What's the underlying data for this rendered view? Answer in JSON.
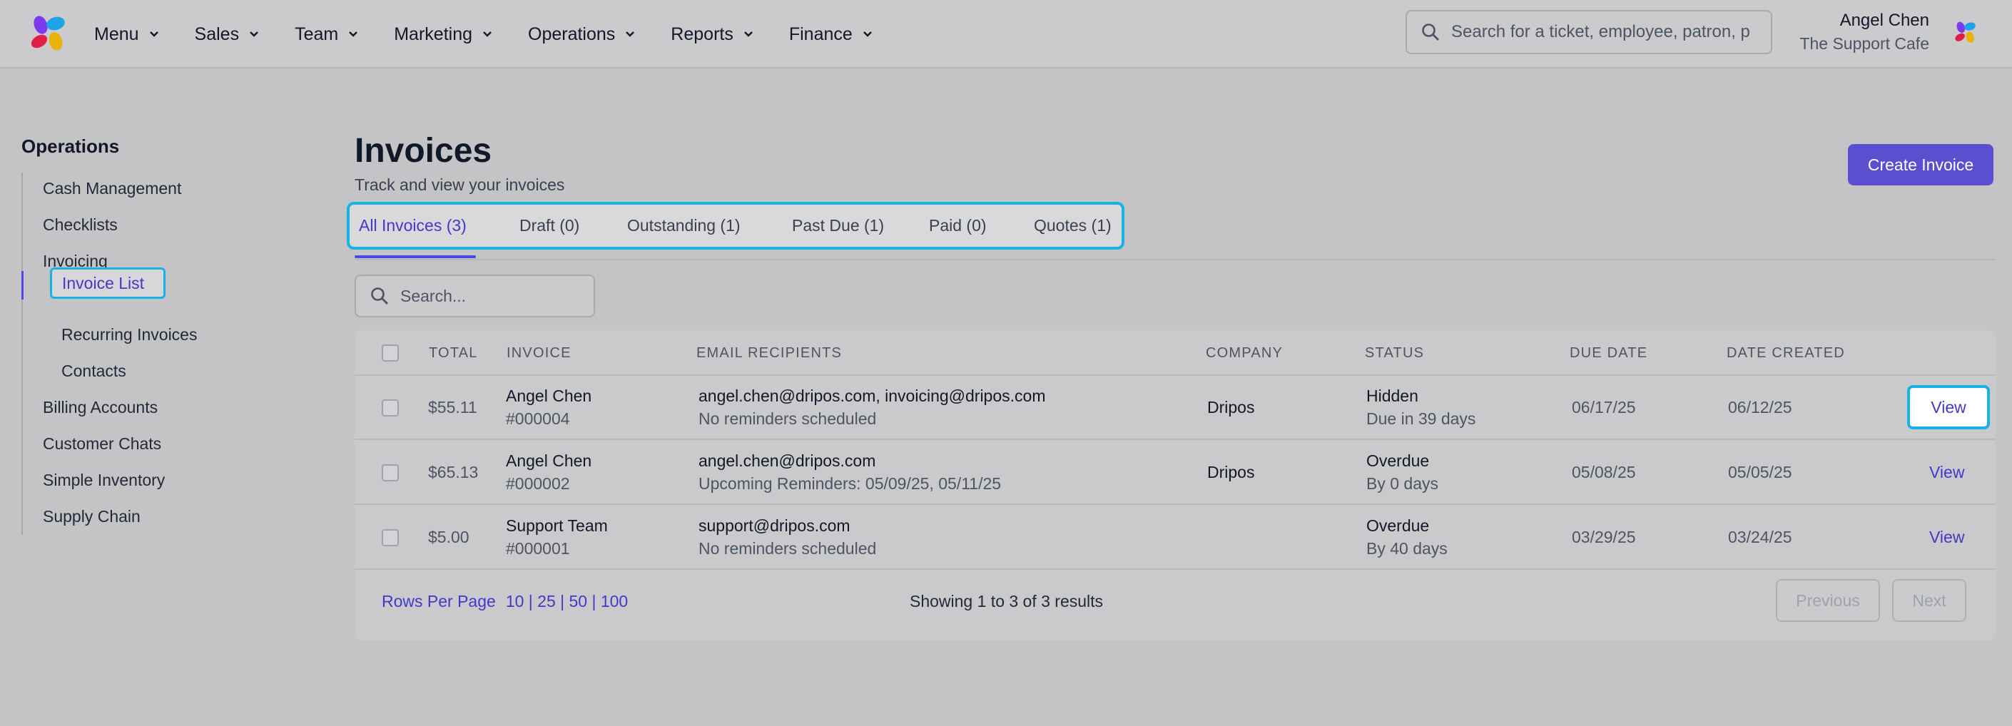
{
  "header": {
    "nav": [
      {
        "label": "Menu"
      },
      {
        "label": "Sales"
      },
      {
        "label": "Team"
      },
      {
        "label": "Marketing"
      },
      {
        "label": "Operations"
      },
      {
        "label": "Reports"
      },
      {
        "label": "Finance"
      }
    ],
    "search_placeholder": "Search for a ticket, employee, patron, p",
    "user_name": "Angel Chen",
    "user_org": "The Support Cafe"
  },
  "sidebar": {
    "title": "Operations",
    "items": [
      {
        "label": "Cash Management"
      },
      {
        "label": "Checklists"
      },
      {
        "label": "Invoicing"
      },
      {
        "label": "Invoice List"
      },
      {
        "label": "Recurring Invoices"
      },
      {
        "label": "Contacts"
      },
      {
        "label": "Billing Accounts"
      },
      {
        "label": "Customer Chats"
      },
      {
        "label": "Simple Inventory"
      },
      {
        "label": "Supply Chain"
      }
    ],
    "active_item": "Invoice List"
  },
  "main": {
    "title": "Invoices",
    "subtitle": "Track and view your invoices",
    "create_button": "Create Invoice",
    "tabs": [
      {
        "label": "All Invoices (3)",
        "active": true
      },
      {
        "label": "Draft (0)"
      },
      {
        "label": "Outstanding (1)"
      },
      {
        "label": "Past Due (1)"
      },
      {
        "label": "Paid (0)"
      },
      {
        "label": "Quotes (1)"
      }
    ],
    "search_placeholder": "Search...",
    "table": {
      "columns": [
        "TOTAL",
        "INVOICE",
        "EMAIL RECIPIENTS",
        "COMPANY",
        "STATUS",
        "DUE DATE",
        "DATE CREATED"
      ],
      "rows": [
        {
          "total": "$55.11",
          "name": "Angel Chen",
          "number": "#000004",
          "emails": "angel.chen@dripos.com, invoicing@dripos.com",
          "reminders": "No reminders scheduled",
          "company": "Dripos",
          "status": "Hidden",
          "status_detail": "Due in 39 days",
          "due_date": "06/17/25",
          "date_created": "06/12/25",
          "action": "View"
        },
        {
          "total": "$65.13",
          "name": "Angel Chen",
          "number": "#000002",
          "emails": "angel.chen@dripos.com",
          "reminders": "Upcoming Reminders: 05/09/25, 05/11/25",
          "company": "Dripos",
          "status": "Overdue",
          "status_detail": "By 0 days",
          "due_date": "05/08/25",
          "date_created": "05/05/25",
          "action": "View"
        },
        {
          "total": "$5.00",
          "name": "Support Team",
          "number": "#000001",
          "emails": "support@dripos.com",
          "reminders": "No reminders scheduled",
          "company": "",
          "status": "Overdue",
          "status_detail": "By 40 days",
          "due_date": "03/29/25",
          "date_created": "03/24/25",
          "action": "View"
        }
      ]
    },
    "footer": {
      "rows_per_page_label": "Rows Per Page",
      "rows_per_page_options": "10 | 25 | 50 | 100",
      "showing": "Showing 1 to 3 of 3 results",
      "previous": "Previous",
      "next": "Next"
    }
  },
  "colors": {
    "accent": "#4f46e5",
    "highlight": "#18b3e6",
    "button": "#5b4fcf"
  },
  "icons": {
    "logo": "pinwheel-logo-icon",
    "search": "search-icon",
    "chevron": "chevron-down-icon"
  }
}
